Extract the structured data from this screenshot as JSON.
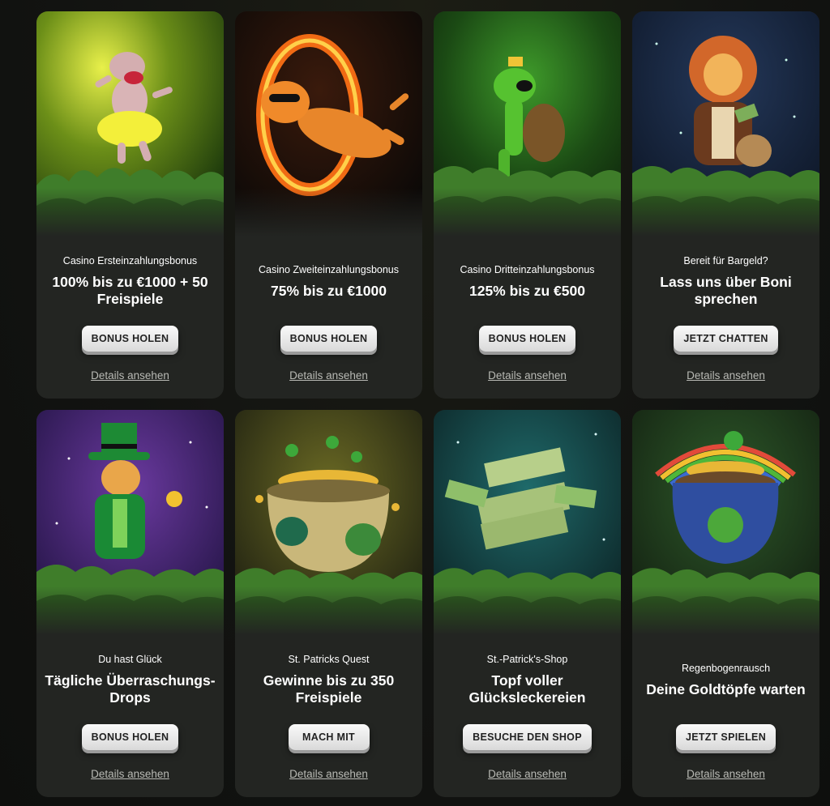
{
  "cards": [
    {
      "subtitle": "Casino Ersteinzahlungsbonus",
      "title": "100% bis zu €1000 + 50 Freispiele",
      "button": "BONUS HOLEN",
      "details": "Details ansehen"
    },
    {
      "subtitle": "Casino Zweiteinzahlungsbonus",
      "title": "75% bis zu €1000",
      "button": "BONUS HOLEN",
      "details": "Details ansehen"
    },
    {
      "subtitle": "Casino Dritteinzahlungsbonus",
      "title": "125% bis zu €500",
      "button": "BONUS HOLEN",
      "details": "Details ansehen"
    },
    {
      "subtitle": "Bereit für Bargeld?",
      "title": "Lass uns über Boni sprechen",
      "button": "JETZT CHATTEN",
      "details": "Details ansehen"
    },
    {
      "subtitle": "Du hast Glück",
      "title": "Tägliche Überraschungs-Drops",
      "button": "BONUS HOLEN",
      "details": "Details ansehen"
    },
    {
      "subtitle": "St. Patricks Quest",
      "title": "Gewinne bis zu 350 Freispiele",
      "button": "MACH MIT",
      "details": "Details ansehen"
    },
    {
      "subtitle": "St.-Patrick's-Shop",
      "title": "Topf voller Glücksleckereien",
      "button": "BESUCHE DEN SHOP",
      "details": "Details ansehen"
    },
    {
      "subtitle": "Regenbogenrausch",
      "title": "Deine Goldtöpfe warten",
      "button": "JETZT SPIELEN",
      "details": "Details ansehen"
    }
  ],
  "illustrations": [
    "hippo-illustration",
    "tiger-illustration",
    "turtle-illustration",
    "lion-illustration",
    "leprechaun-leopard-illustration",
    "pot-of-gold-illustration",
    "cash-stacks-illustration",
    "rainbow-pot-illustration"
  ],
  "colors": {
    "card_bg": "#232522",
    "page_bg": "#121311",
    "button_bg": "#eeeeee",
    "button_text": "#222222",
    "link_text": "#b9bab5",
    "foliage": "#3f7d2a"
  }
}
